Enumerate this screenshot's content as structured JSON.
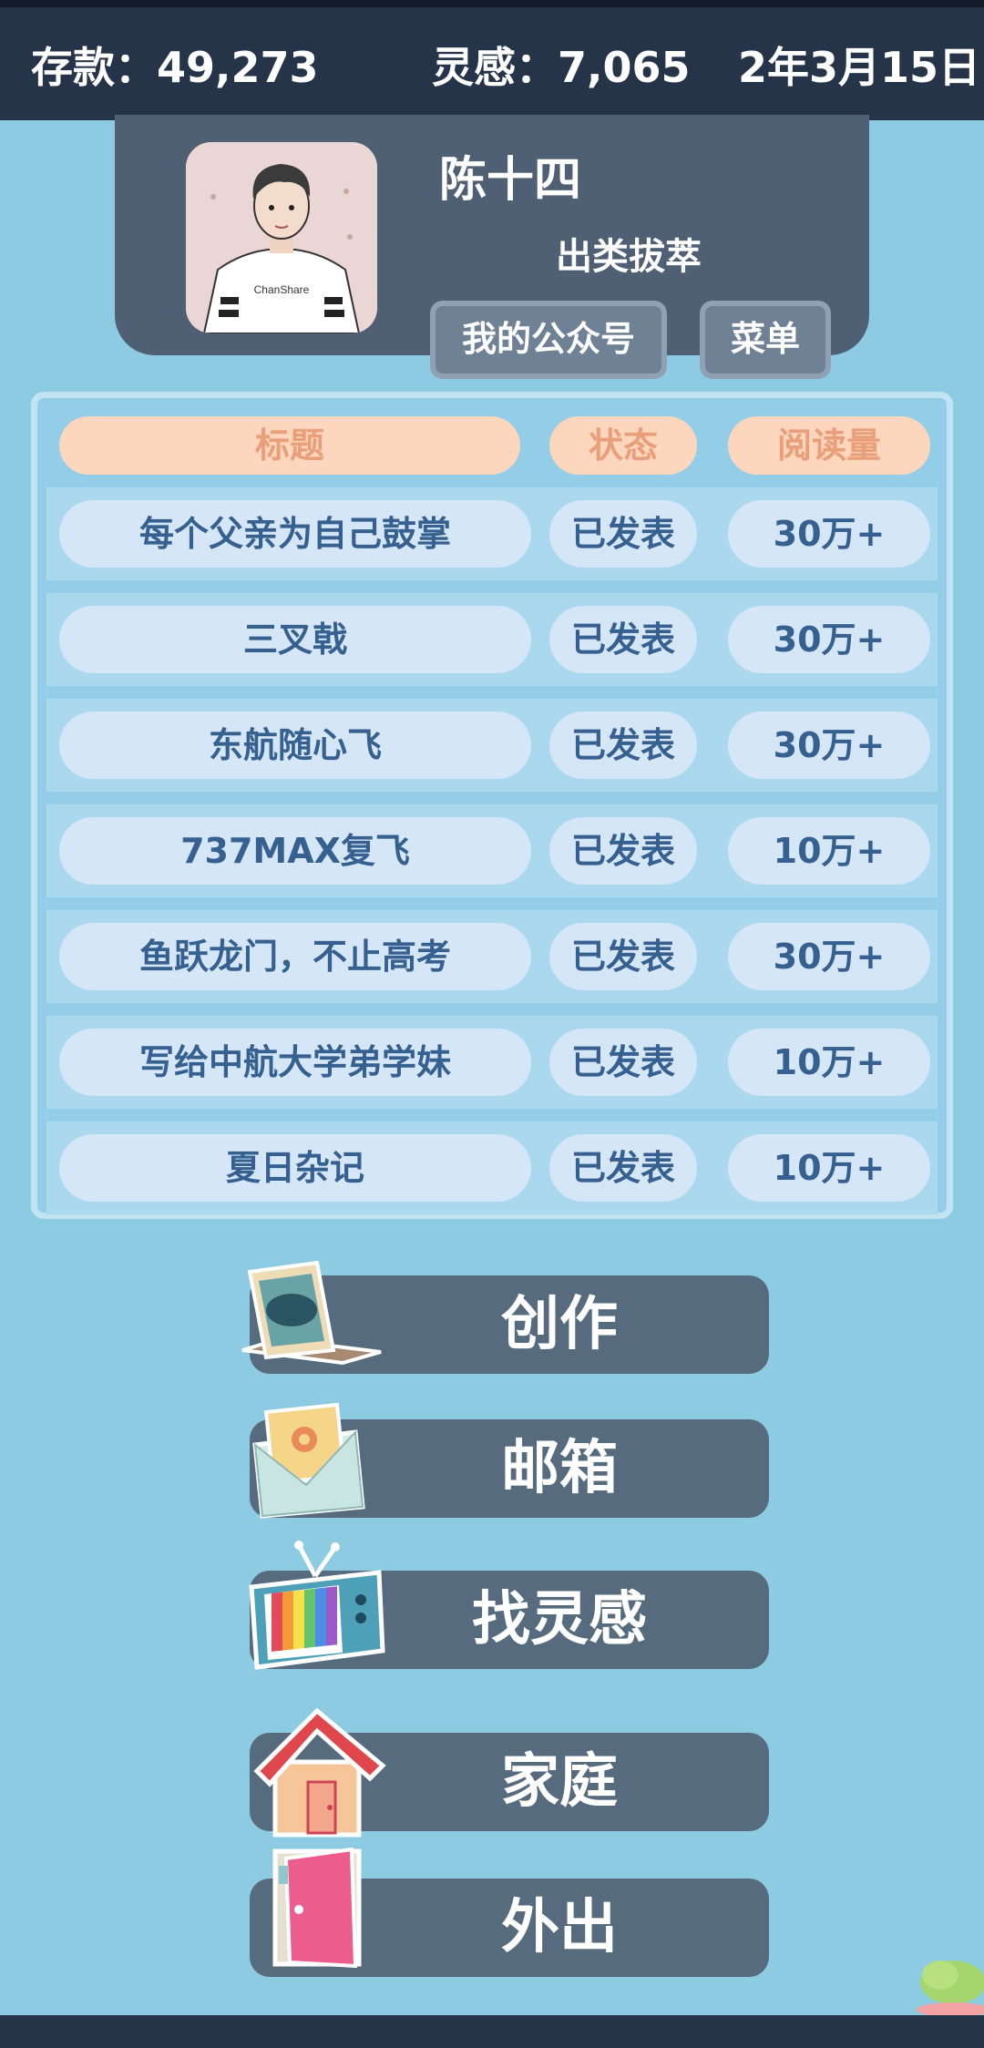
{
  "topbar": {
    "savings": "存款：49,273",
    "inspiration": "灵感：7,065",
    "date": "2年3月15日"
  },
  "profile": {
    "name": "陈十四",
    "title": "出类拔萃",
    "avatar_shirt_text": "ChanShare",
    "btn_account": "我的公众号",
    "btn_menu": "菜单"
  },
  "table": {
    "headers": {
      "title": "标题",
      "status": "状态",
      "reads": "阅读量"
    },
    "rows": [
      {
        "title": "每个父亲为自己鼓掌",
        "status": "已发表",
        "reads": "30万+"
      },
      {
        "title": "三叉戟",
        "status": "已发表",
        "reads": "30万+"
      },
      {
        "title": "东航随心飞",
        "status": "已发表",
        "reads": "30万+"
      },
      {
        "title": "737MAX复飞",
        "status": "已发表",
        "reads": "10万+"
      },
      {
        "title": "鱼跃龙门，不止高考",
        "status": "已发表",
        "reads": "30万+"
      },
      {
        "title": "写给中航大学弟学妹",
        "status": "已发表",
        "reads": "10万+"
      },
      {
        "title": "夏日杂记",
        "status": "已发表",
        "reads": "10万+"
      }
    ]
  },
  "menu": {
    "create": "创作",
    "mailbox": "邮箱",
    "find_inspiration": "找灵感",
    "family": "家庭",
    "go_out": "外出"
  },
  "icons": [
    "laptop-icon",
    "mail-icon",
    "tv-icon",
    "house-icon",
    "door-icon",
    "bush-icon"
  ]
}
